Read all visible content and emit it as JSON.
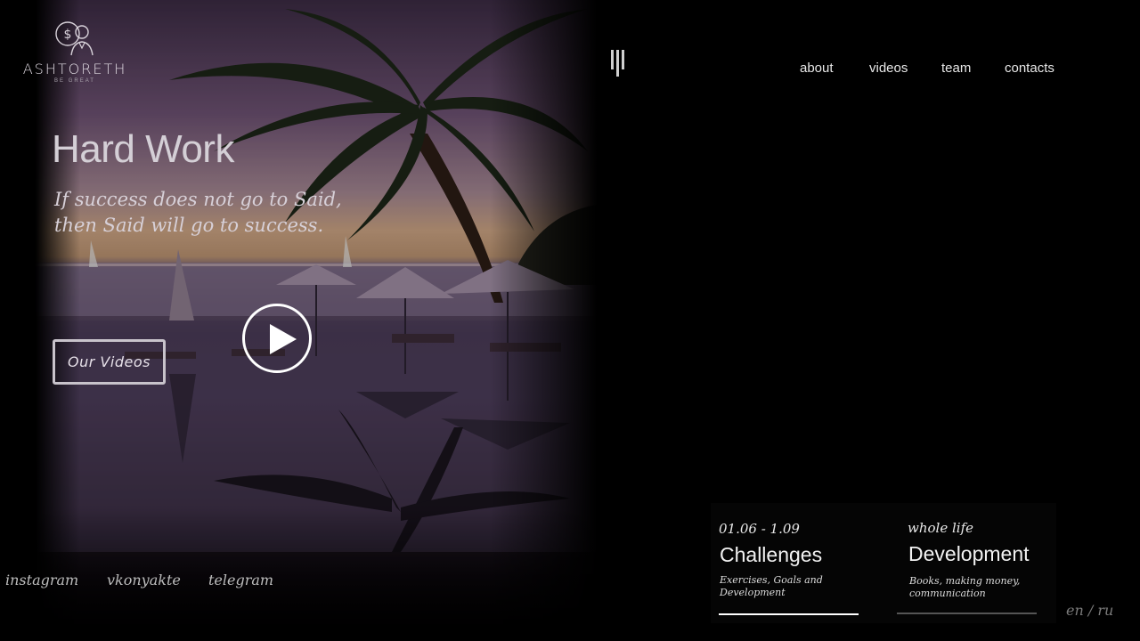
{
  "brand": {
    "name": "ASHTORETH",
    "tagline": "BE GREAT"
  },
  "nav": {
    "items": [
      {
        "label": "about"
      },
      {
        "label": "videos"
      },
      {
        "label": "team"
      },
      {
        "label": "contacts"
      }
    ]
  },
  "hero": {
    "title": "Hard Work",
    "quote_line1": "If success does not go to Said,",
    "quote_line2": "then Said will go to success.",
    "videos_button": "Our Videos",
    "play_icon": "play-icon"
  },
  "social": {
    "links": [
      {
        "label": "instagram"
      },
      {
        "label": "vkonyakte"
      },
      {
        "label": "telegram"
      }
    ]
  },
  "cards": [
    {
      "date": "01.06 - 1.09",
      "title": "Challenges",
      "description": "Exercises, Goals and Development",
      "active": true
    },
    {
      "date": "whole life",
      "title": "Development",
      "description": "Books, making money, communication",
      "active": false
    }
  ],
  "language": {
    "en": "en",
    "separator": "/",
    "ru": "ru"
  },
  "colors": {
    "background": "#000000",
    "text": "#e8e8e8",
    "bar_active": "#ffffff",
    "bar_inactive": "#555555"
  }
}
